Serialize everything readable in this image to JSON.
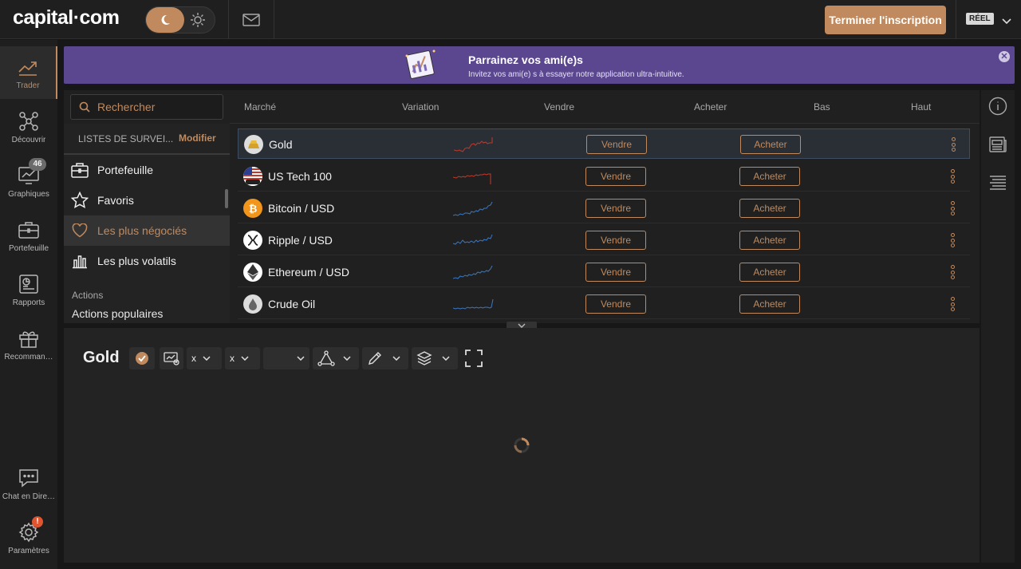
{
  "header": {
    "logo": "capital·com",
    "finish_label": "Terminer l'inscription",
    "account_type": "RÉEL",
    "icons": [
      "moon-icon",
      "sun-icon",
      "mail-icon",
      "chevron-down-icon"
    ]
  },
  "sidebar": {
    "items": [
      {
        "label": "Trader",
        "icon": "trend-up-icon",
        "active": true
      },
      {
        "label": "Découvrir",
        "icon": "network-icon"
      },
      {
        "label": "Graphiques",
        "icon": "chart-monitor-icon",
        "badge": "46"
      },
      {
        "label": "Portefeuille",
        "icon": "briefcase-icon"
      },
      {
        "label": "Rapports",
        "icon": "report-icon"
      },
      {
        "label": "Recommandations",
        "display": "Recomman…",
        "icon": "gift-icon"
      },
      {
        "label": "Chat en Direct",
        "display": "Chat en Dire…",
        "icon": "chat-icon"
      },
      {
        "label": "Paramètres",
        "icon": "gear-icon",
        "badge": "!"
      }
    ]
  },
  "banner": {
    "title": "Parrainez vos ami(e)s",
    "subtitle": "Invitez vos ami(e) s à essayer notre application ultra-intuitive."
  },
  "search": {
    "placeholder": "Rechercher"
  },
  "columns": [
    "Marché",
    "Variation",
    "Vendre",
    "Acheter",
    "Bas",
    "Haut"
  ],
  "watchlists": {
    "title": "LISTES DE SURVEI...",
    "edit_label": "Modifier",
    "items": [
      {
        "label": "Portefeuille",
        "icon": "briefcase-icon"
      },
      {
        "label": "Favoris",
        "icon": "star-icon"
      },
      {
        "label": "Les plus négociés",
        "icon": "heart-icon",
        "active": true
      },
      {
        "label": "Les plus volatils",
        "icon": "bar-chart-icon"
      }
    ],
    "section_title": "Actions",
    "section_item": "Actions populaires"
  },
  "markets": [
    {
      "name": "Gold",
      "icon": "gold-bar-icon",
      "trend_color": "#c0392b",
      "sell": "Vendre",
      "buy": "Acheter",
      "selected": true
    },
    {
      "name": "US Tech 100",
      "icon": "us-flag-icon",
      "trend_color": "#c0392b",
      "sell": "Vendre",
      "buy": "Acheter"
    },
    {
      "name": "Bitcoin / USD",
      "icon": "bitcoin-icon",
      "trend_color": "#3a78c2",
      "sell": "Vendre",
      "buy": "Acheter"
    },
    {
      "name": "Ripple / USD",
      "icon": "ripple-icon",
      "trend_color": "#3a78c2",
      "sell": "Vendre",
      "buy": "Acheter"
    },
    {
      "name": "Ethereum / USD",
      "icon": "ethereum-icon",
      "trend_color": "#3a78c2",
      "sell": "Vendre",
      "buy": "Acheter"
    },
    {
      "name": "Crude Oil",
      "icon": "oil-drop-icon",
      "trend_color": "#3a78c2",
      "sell": "Vendre",
      "buy": "Acheter"
    }
  ],
  "chart": {
    "title": "Gold",
    "toolbar": {
      "interval_1": "x",
      "interval_2": "x"
    },
    "icons": [
      "check-icon",
      "indicator-icon",
      "drawing-tools-icon",
      "pencil-icon",
      "layers-icon",
      "fullscreen-icon"
    ]
  },
  "colors": {
    "accent": "#c08a5e",
    "banner": "#5b478f",
    "bg": "#171717"
  }
}
